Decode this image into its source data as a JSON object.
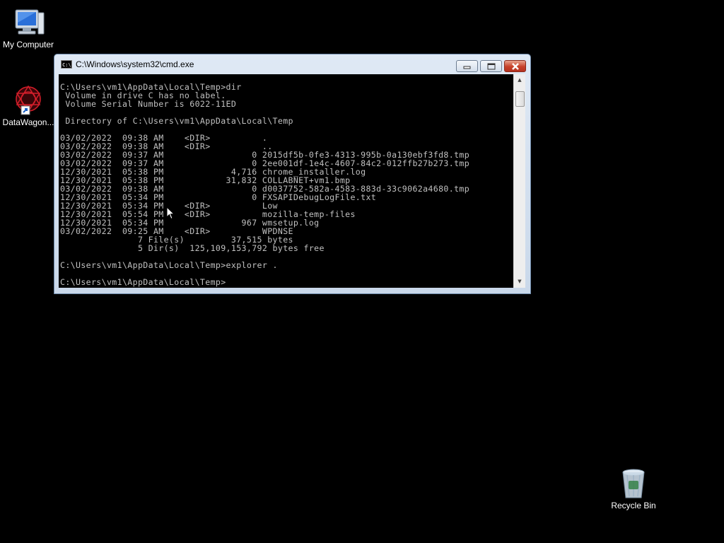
{
  "desktop": {
    "icons": [
      {
        "label": "My Computer",
        "icon": "computer-icon"
      },
      {
        "label": "DataWagon...",
        "icon": "datawagon-shortcut-icon"
      },
      {
        "label": "Recycle Bin",
        "icon": "recycle-bin-icon"
      }
    ]
  },
  "window": {
    "title": "C:\\Windows\\system32\\cmd.exe",
    "icon": "cmd-icon",
    "controls": [
      "minimize-icon",
      "maximize-icon",
      "close-icon"
    ],
    "console_lines": [
      "C:\\Users\\vm1\\AppData\\Local\\Temp>dir",
      " Volume in drive C has no label.",
      " Volume Serial Number is 6022-11ED",
      "",
      " Directory of C:\\Users\\vm1\\AppData\\Local\\Temp",
      "",
      "03/02/2022  09:38 AM    <DIR>          .",
      "03/02/2022  09:38 AM    <DIR>          ..",
      "03/02/2022  09:37 AM                 0 2015df5b-0fe3-4313-995b-0a130ebf3fd8.tmp",
      "03/02/2022  09:37 AM                 0 2ee001df-1e4c-4607-84c2-012ffb27b273.tmp",
      "12/30/2021  05:38 PM             4,716 chrome_installer.log",
      "12/30/2021  05:38 PM            31,832 COLLABNET+vm1.bmp",
      "03/02/2022  09:38 AM                 0 d0037752-582a-4583-883d-33c9062a4680.tmp",
      "12/30/2021  05:34 PM                 0 FXSAPIDebugLogFile.txt",
      "12/30/2021  05:34 PM    <DIR>          Low",
      "12/30/2021  05:54 PM    <DIR>          mozilla-temp-files",
      "12/30/2021  05:34 PM               967 wmsetup.log",
      "03/02/2022  09:25 AM    <DIR>          WPDNSE",
      "               7 File(s)         37,515 bytes",
      "               5 Dir(s)  125,109,153,792 bytes free",
      "",
      "C:\\Users\\vm1\\AppData\\Local\\Temp>explorer .",
      "",
      "C:\\Users\\vm1\\AppData\\Local\\Temp>"
    ]
  }
}
